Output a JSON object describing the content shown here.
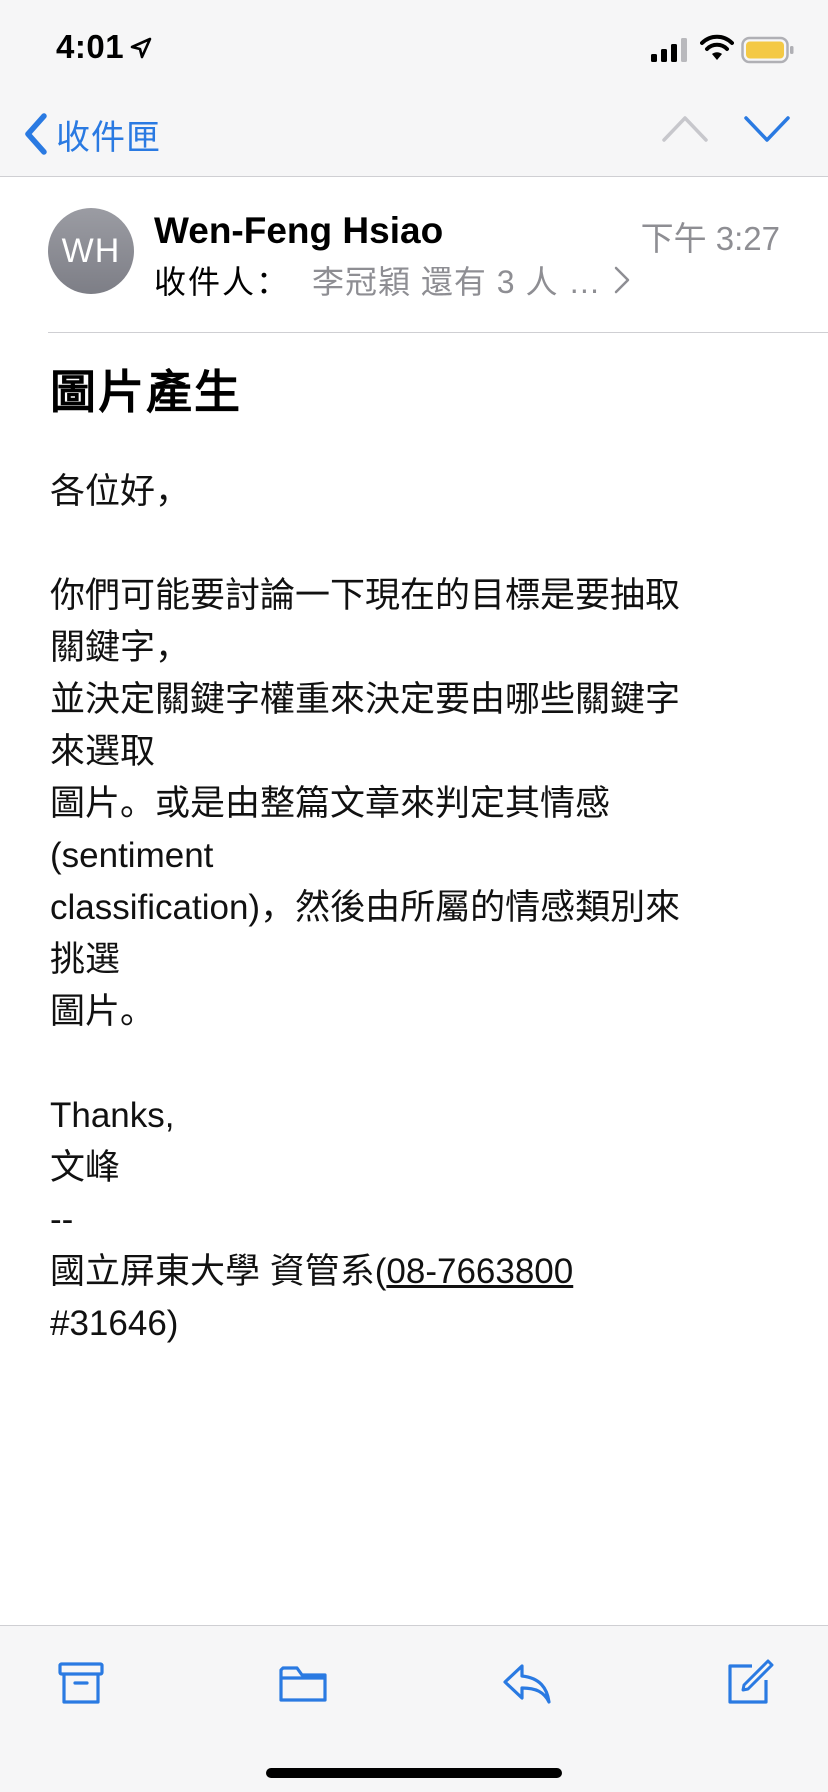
{
  "status_bar": {
    "time": "4:01",
    "icons": [
      "location-arrow-icon",
      "cellular-signal-icon",
      "wifi-icon",
      "battery-icon"
    ]
  },
  "nav": {
    "back_label": "收件匣",
    "icons": [
      "chevron-left-icon",
      "chevron-up-icon",
      "chevron-down-icon"
    ]
  },
  "header": {
    "avatar_initials": "WH",
    "sender": "Wen-Feng Hsiao",
    "time": "下午 3:27",
    "recipients_label": "收件人：",
    "recipients_value": "李冠穎 還有 3 人 …"
  },
  "message": {
    "subject": "圖片產生",
    "lines": [
      "各位好，",
      "",
      "你們可能要討論一下現在的目標是要抽取",
      "關鍵字，",
      "並決定關鍵字權重來決定要由哪些關鍵字",
      "來選取",
      "圖片。或是由整篇文章來判定其情感",
      "(sentiment",
      "classification)，然後由所屬的情感類別來",
      "挑選",
      "圖片。",
      "",
      "Thanks,",
      "文峰",
      "--"
    ],
    "signature_prefix": "國立屏東大學 資管系(",
    "phone_part1": "08-7663800",
    "phone_part2": "#31646",
    "signature_suffix": ")"
  },
  "toolbar": {
    "icons": [
      "archive-icon",
      "folder-icon",
      "reply-icon",
      "compose-icon"
    ]
  },
  "colors": {
    "accent": "#2a7ae2",
    "secondary_text": "#8e8e93",
    "bar_background": "#f6f6f7",
    "divider": "#cfcfd3",
    "battery": "#f4c945"
  }
}
